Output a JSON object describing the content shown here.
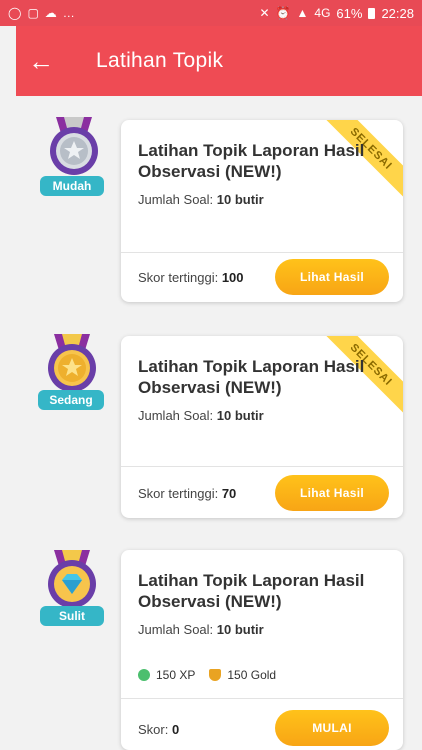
{
  "statusbar": {
    "battery": "61%",
    "time": "22:28",
    "net": "4G"
  },
  "header": {
    "title": "Latihan Topik"
  },
  "items": [
    {
      "difficulty": "Mudah",
      "title": "Latihan Topik Laporan Hasil Observasi (NEW!)",
      "jumlah_label": "Jumlah Soal: ",
      "jumlah_value": "10 butir",
      "score_label": "Skor tertinggi: ",
      "score_value": "100",
      "button": "Lihat Hasil",
      "ribbon": "SELESAI",
      "medal": "silver"
    },
    {
      "difficulty": "Sedang",
      "title": "Latihan Topik Laporan Hasil Observasi (NEW!)",
      "jumlah_label": "Jumlah Soal: ",
      "jumlah_value": "10 butir",
      "score_label": "Skor tertinggi: ",
      "score_value": "70",
      "button": "Lihat Hasil",
      "ribbon": "SELESAI",
      "medal": "gold"
    },
    {
      "difficulty": "Sulit",
      "title": "Latihan Topik Laporan Hasil Observasi (NEW!)",
      "jumlah_label": "Jumlah Soal: ",
      "jumlah_value": "10 butir",
      "xp": "150 XP",
      "gold": "150 Gold",
      "score_label": "Skor: ",
      "score_value": "0",
      "button": "MULAI",
      "medal": "diamond"
    }
  ],
  "colors": {
    "header": "#ef4b54",
    "accent": "#f8a515",
    "badge": "#35b6c7"
  }
}
